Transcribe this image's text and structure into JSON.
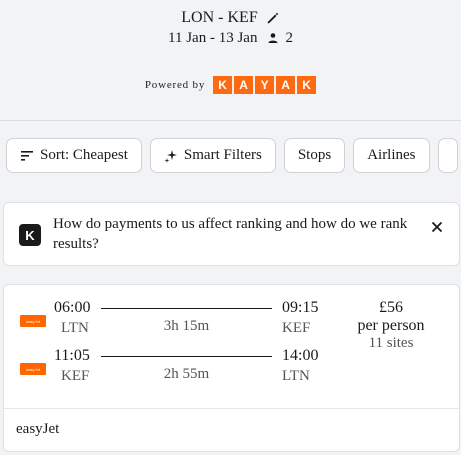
{
  "header": {
    "route": "LON - KEF",
    "dates": "11 Jan - 13 Jan",
    "passengers": "2",
    "powered_by": "Powered by",
    "provider_letters": [
      "K",
      "A",
      "Y",
      "A",
      "K"
    ],
    "provider_color": "#ff690f"
  },
  "chips": [
    {
      "label": "Sort: Cheapest",
      "icon": "sort-icon"
    },
    {
      "label": "Smart Filters",
      "icon": "sparkle-icon"
    },
    {
      "label": "Stops"
    },
    {
      "label": "Airlines"
    }
  ],
  "banner": {
    "text": "How do payments to us affect ranking and how do we rank results?",
    "logo_letter": "K"
  },
  "result": {
    "airline_logo_text": "easyJet",
    "airline_color": "#ff6600",
    "outbound": {
      "dep_time": "06:00",
      "dep_airport": "LTN",
      "duration": "3h 15m",
      "arr_time": "09:15",
      "arr_airport": "KEF"
    },
    "inbound": {
      "dep_time": "11:05",
      "dep_airport": "KEF",
      "duration": "2h 55m",
      "arr_time": "14:00",
      "arr_airport": "LTN"
    },
    "price": "£56",
    "per_person": "per person",
    "sites": "11 sites",
    "carrier": "easyJet"
  }
}
